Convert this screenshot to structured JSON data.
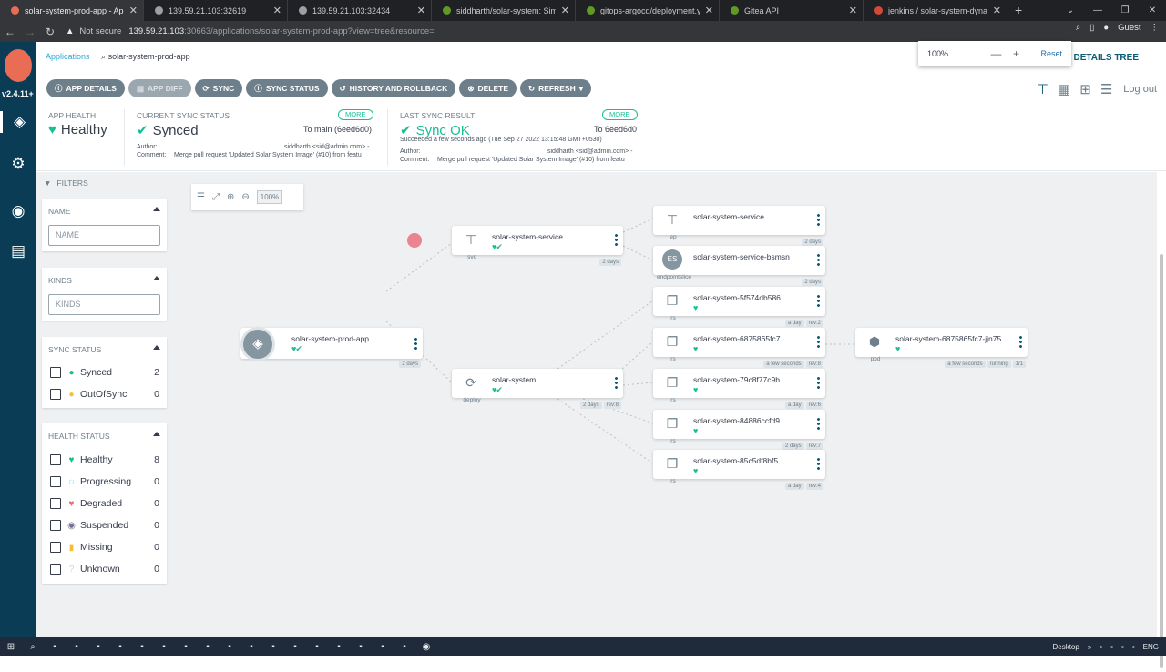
{
  "browser": {
    "tabs": [
      {
        "title": "solar-system-prod-app - Applic",
        "active": true,
        "color": "#e96d54"
      },
      {
        "title": "139.59.21.103:32619",
        "active": false,
        "color": "#9aa0a6"
      },
      {
        "title": "139.59.21.103:32434",
        "active": false,
        "color": "#9aa0a6"
      },
      {
        "title": "siddharth/solar-system: Simple",
        "active": false,
        "color": "#609926"
      },
      {
        "title": "gitops-argocd/deployment.yam",
        "active": false,
        "color": "#609926"
      },
      {
        "title": "Gitea API",
        "active": false,
        "color": "#609926"
      },
      {
        "title": "jenkins / solar-system-dynamic",
        "active": false,
        "color": "#d24939"
      }
    ],
    "not_secure": "Not secure",
    "url_host": "139.59.21.103",
    "url_path": ":30663/applications/solar-system-prod-app?view=tree&resource=",
    "profile": "Guest"
  },
  "zoom_popup": {
    "value": "100%",
    "minus": "—",
    "plus": "+",
    "reset": "Reset"
  },
  "sidebar": {
    "version": "v2.4.11+"
  },
  "breadcrumb": {
    "root": "Applications",
    "current": "solar-system-prod-app"
  },
  "header_title": "ATION DETAILS TREE",
  "toolbar": {
    "app_details": "APP DETAILS",
    "app_diff": "APP DIFF",
    "sync": "SYNC",
    "sync_status": "SYNC STATUS",
    "history": "HISTORY AND ROLLBACK",
    "delete": "DELETE",
    "refresh": "REFRESH"
  },
  "logout": "Log out",
  "status": {
    "app_health_label": "APP HEALTH",
    "app_health_value": "Healthy",
    "sync_label": "CURRENT SYNC STATUS",
    "sync_value": "Synced",
    "sync_more": "MORE",
    "sync_to": "To main (6eed6d0)",
    "sync_author_label": "Author:",
    "sync_author": "siddharth <sid@admin.com> -",
    "sync_comment_label": "Comment:",
    "sync_comment": "Merge pull request 'Updated Solar System Image' (#10) from featu",
    "result_label": "LAST SYNC RESULT",
    "result_value": "Sync OK",
    "result_more": "MORE",
    "result_to": "To 6eed6d0",
    "result_time": "Succeeded a few seconds ago (Tue Sep 27 2022 13:15:48 GMT+0530)",
    "result_author_label": "Author:",
    "result_author": "siddharth <sid@admin.com> -",
    "result_comment_label": "Comment:",
    "result_comment": "Merge pull request 'Updated Solar System Image' (#10) from featu"
  },
  "filters": {
    "title": "FILTERS",
    "name_title": "NAME",
    "name_placeholder": "NAME",
    "kinds_title": "KINDS",
    "kinds_placeholder": "KINDS",
    "sync_title": "SYNC STATUS",
    "sync_items": [
      {
        "label": "Synced",
        "count": "2"
      },
      {
        "label": "OutOfSync",
        "count": "0"
      }
    ],
    "health_title": "HEALTH STATUS",
    "health_items": [
      {
        "label": "Healthy",
        "count": "8"
      },
      {
        "label": "Progressing",
        "count": "0"
      },
      {
        "label": "Degraded",
        "count": "0"
      },
      {
        "label": "Suspended",
        "count": "0"
      },
      {
        "label": "Missing",
        "count": "0"
      },
      {
        "label": "Unknown",
        "count": "0"
      }
    ]
  },
  "canvas": {
    "zoom": "100%",
    "app": {
      "name": "solar-system-prod-app",
      "age": "2 days"
    },
    "svc": {
      "name": "solar-system-service",
      "kind": "svc",
      "age": "2 days"
    },
    "deploy": {
      "name": "solar-system",
      "kind": "deploy",
      "age": "2 days",
      "rev": "rev:8"
    },
    "ep": {
      "name": "solar-system-service",
      "kind": "ep",
      "age": "2 days"
    },
    "eps": {
      "name": "solar-system-service-bsmsn",
      "kind": "endpointslice",
      "age": "2 days",
      "icon": "ES"
    },
    "rs": [
      {
        "name": "solar-system-5f574db586",
        "kind": "rs",
        "age": "a day",
        "rev": "rev:2"
      },
      {
        "name": "solar-system-6875865fc7",
        "kind": "rs",
        "age": "a few seconds",
        "rev": "rev:8"
      },
      {
        "name": "solar-system-79c8f77c9b",
        "kind": "rs",
        "age": "a day",
        "rev": "rev:6"
      },
      {
        "name": "solar-system-84886ccfd9",
        "kind": "rs",
        "age": "2 days",
        "rev": "rev:7"
      },
      {
        "name": "solar-system-85c5df8bf5",
        "kind": "rs",
        "age": "a day",
        "rev": "rev:4"
      }
    ],
    "pod": {
      "name": "solar-system-6875865fc7-jjn75",
      "kind": "pod",
      "age": "a few seconds",
      "state": "running",
      "ready": "1/1"
    }
  },
  "taskbar": {
    "desktop": "Desktop",
    "lang": "ENG"
  }
}
